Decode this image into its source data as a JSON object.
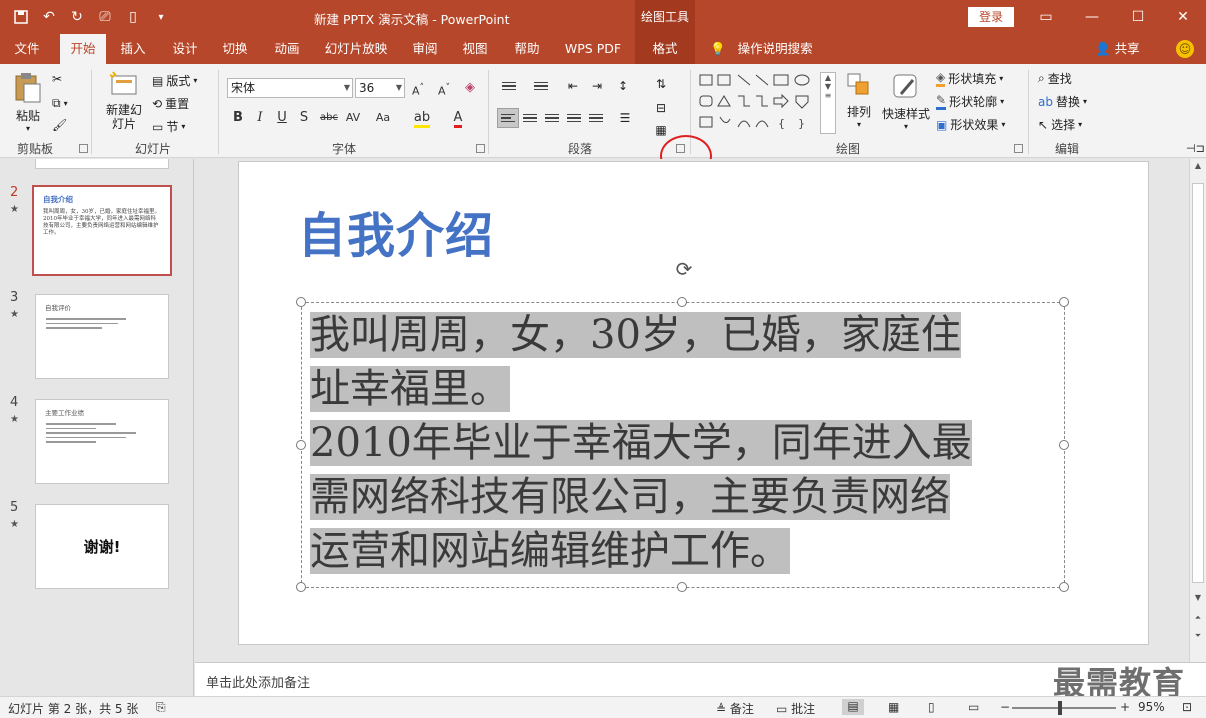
{
  "titlebar": {
    "title": "新建 PPTX 演示文稿 - PowerPoint",
    "context_tab": "绘图工具",
    "login": "登录"
  },
  "tabs": [
    "文件",
    "开始",
    "插入",
    "设计",
    "切换",
    "动画",
    "幻灯片放映",
    "审阅",
    "视图",
    "帮助",
    "WPS PDF",
    "格式"
  ],
  "tell_me": "操作说明搜索",
  "share": "共享",
  "ribbon": {
    "clipboard": {
      "paste": "粘贴",
      "label": "剪贴板"
    },
    "slides": {
      "new_slide": "新建幻灯片",
      "layout": "版式",
      "reset": "重置",
      "section": "节",
      "label": "幻灯片"
    },
    "font": {
      "name": "宋体",
      "size": "36",
      "label": "字体",
      "buttons": [
        "B",
        "I",
        "U",
        "S",
        "abc",
        "AV",
        "Aa"
      ]
    },
    "paragraph": {
      "label": "段落"
    },
    "drawing": {
      "arrange": "排列",
      "quick_styles": "快速样式",
      "fill": "形状填充",
      "outline": "形状轮廓",
      "effects": "形状效果",
      "label": "绘图"
    },
    "editing": {
      "find": "查找",
      "replace": "替换",
      "select": "选择",
      "label": "编辑"
    }
  },
  "thumbnails": [
    {
      "num": "2",
      "title": "自我介绍",
      "body": "我叫周周，女，30岁，已婚，家庭住址幸福里。2010年毕业于幸福大学，同年进入最需网络科技有限公司，主要负责网络运营和网站编辑维护工作。"
    },
    {
      "num": "3",
      "title": "自我评价"
    },
    {
      "num": "4",
      "title": "主要工作业绩"
    },
    {
      "num": "5",
      "title": "谢谢!"
    }
  ],
  "slide": {
    "title": "自我介绍",
    "lines": [
      "我叫周周，女，30岁，已婚，家庭住",
      "址幸福里。",
      "2010年毕业于幸福大学，同年进入最",
      "需网络科技有限公司，主要负责网络",
      "运营和网站编辑维护工作。"
    ]
  },
  "notes_placeholder": "单击此处添加备注",
  "status": {
    "slide_info": "幻灯片 第 2 张，共 5 张",
    "notes": "备注",
    "comments": "批注",
    "zoom": "95%"
  },
  "watermark": "最需教育",
  "colors": {
    "accent": "#b7472a",
    "title_blue": "#4472c4",
    "highlight": "#bfbfbf",
    "annotation_circle": "#e02020"
  }
}
